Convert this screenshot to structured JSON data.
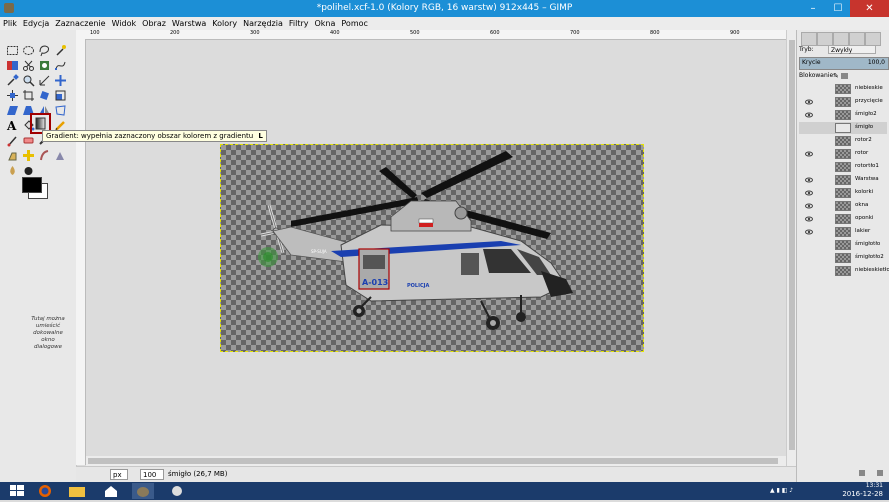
{
  "window": {
    "title": "*polihel.xcf-1.0 (Kolory RGB, 16 warstw) 912x445 – GIMP",
    "minimize": "–",
    "maximize": "☐",
    "close": "✕"
  },
  "menu": [
    "Plik",
    "Edycja",
    "Zaznaczenie",
    "Widok",
    "Obraz",
    "Warstwa",
    "Kolory",
    "Narzędzia",
    "Filtry",
    "Okna",
    "Pomoc"
  ],
  "toolbox": {
    "hint": "Tutaj można umieścić dokowalne okno dialogowe",
    "foreground_color": "#000000",
    "background_color": "#ffffff"
  },
  "tooltip": {
    "text": "Gradient: wypełnia zaznaczony obszar kolorem z gradientu",
    "shortcut": "L"
  },
  "canvas": {
    "ruler_labels": [
      "100",
      "200",
      "300",
      "400",
      "500",
      "600",
      "700",
      "800",
      "900"
    ],
    "helicopter": {
      "id_label": "A-013",
      "police_label": "POLICJA",
      "tail_label": "SP-SUJA",
      "body_color": "#c8c8c8",
      "stripe_color": "#1a3fb0"
    }
  },
  "statusbar": {
    "unit": "px",
    "zoom": "100 %",
    "status": "śmigło (26,7 MB)"
  },
  "layers": {
    "mode_label": "Tryb:",
    "mode_value": "Zwykły",
    "opacity_label": "Krycie",
    "opacity_value": "100,0",
    "lock_label": "Blokowanie:",
    "items": [
      {
        "name": "niebieskie",
        "visible": false
      },
      {
        "name": "przycięcie",
        "visible": true
      },
      {
        "name": "śmigło2",
        "visible": true
      },
      {
        "name": "śmigło",
        "visible": false
      },
      {
        "name": "rotor2",
        "visible": false
      },
      {
        "name": "rotor",
        "visible": true
      },
      {
        "name": "rotortło1",
        "visible": false
      },
      {
        "name": "Warstwa",
        "visible": true
      },
      {
        "name": "kolorki",
        "visible": true
      },
      {
        "name": "okna",
        "visible": true
      },
      {
        "name": "oponki",
        "visible": true
      },
      {
        "name": "lakier",
        "visible": true
      },
      {
        "name": "śmigłotło",
        "visible": false
      },
      {
        "name": "śmigłotło2",
        "visible": false
      },
      {
        "name": "niebieskietło",
        "visible": false
      }
    ]
  },
  "taskbar": {
    "time": "13:31",
    "date": "2016-12-28"
  }
}
